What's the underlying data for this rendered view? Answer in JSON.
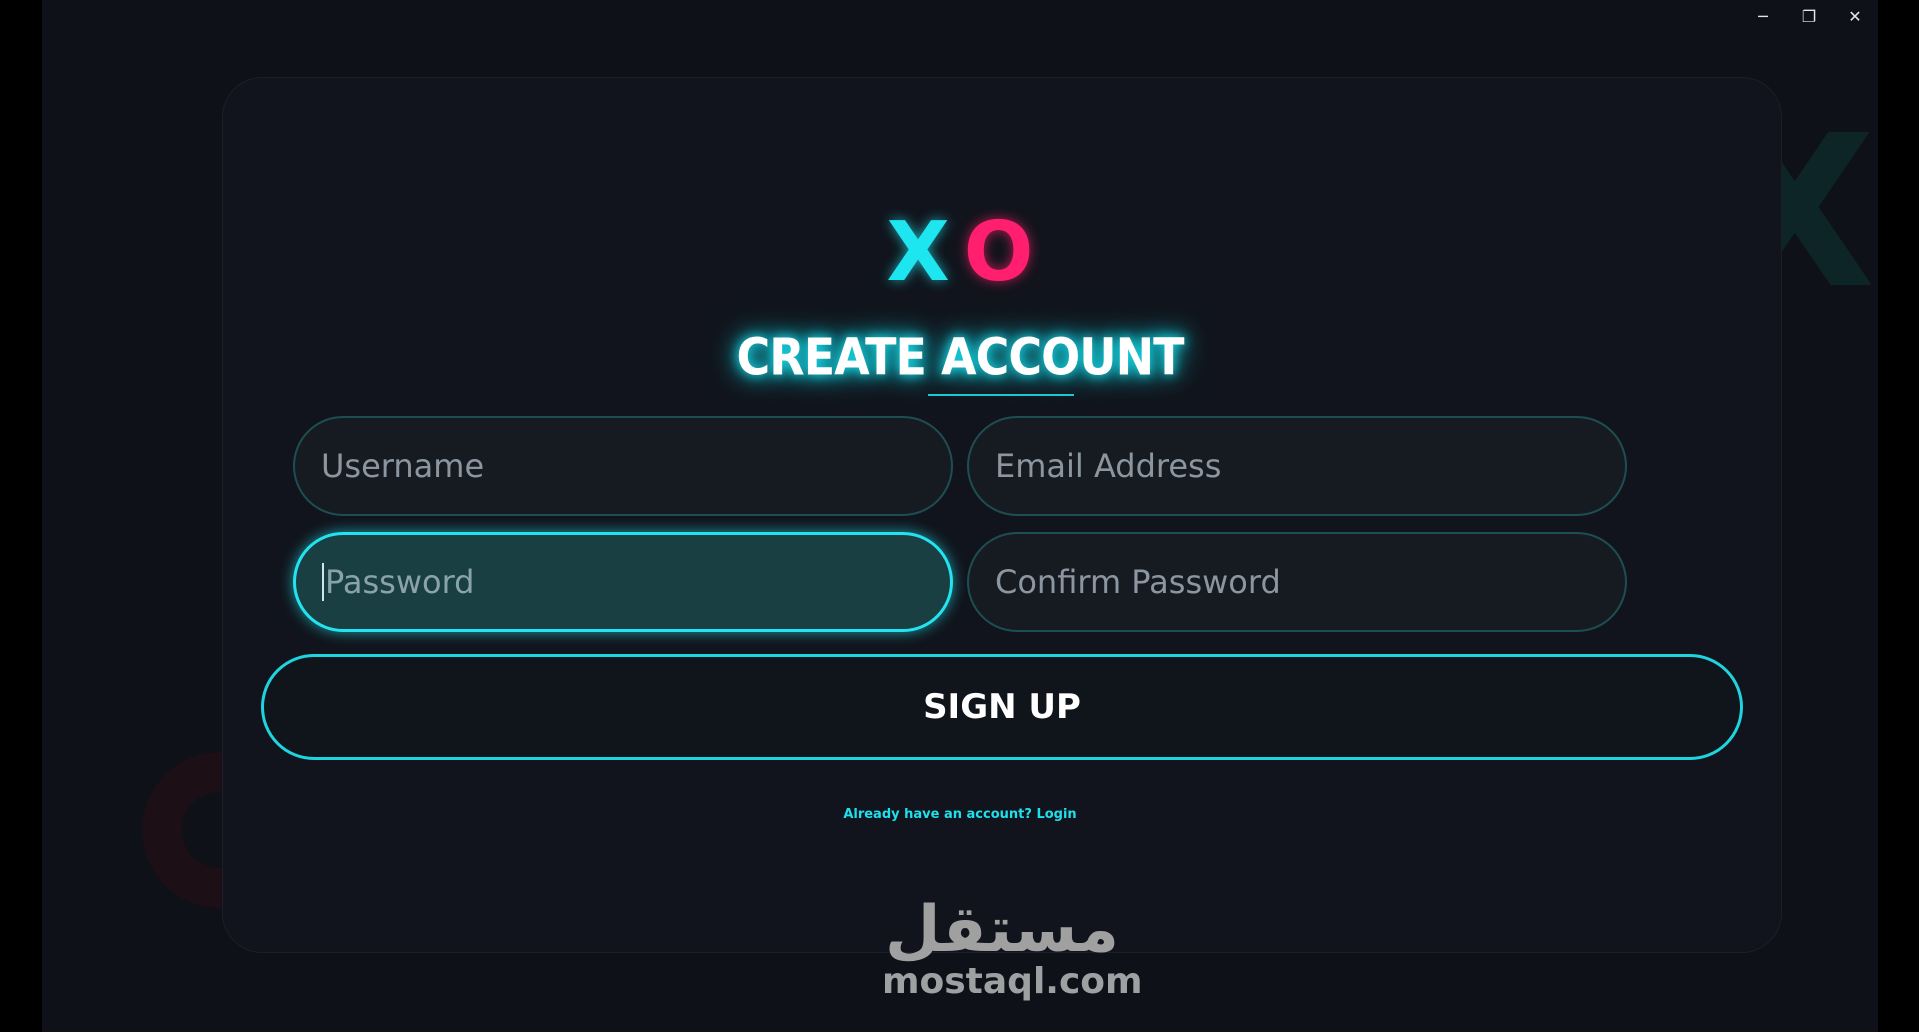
{
  "window": {
    "minimize": "─",
    "restore": "❐",
    "close": "✕"
  },
  "background": {
    "x_glyph": "X"
  },
  "logo": {
    "x": "X",
    "o": "O",
    "x_color": "#1ee6f0",
    "o_color": "#ff1f6e"
  },
  "form": {
    "title": "CREATE ACCOUNT",
    "username_placeholder": "Username",
    "email_placeholder": "Email Address",
    "password_placeholder": "Password",
    "confirm_placeholder": "Confirm Password",
    "submit_label": "SIGN UP",
    "login_link": "Already have an account? Login",
    "accent_color": "#1fd4df"
  },
  "watermark": {
    "arabic": "مستقل",
    "latin": "mostaql.com"
  }
}
